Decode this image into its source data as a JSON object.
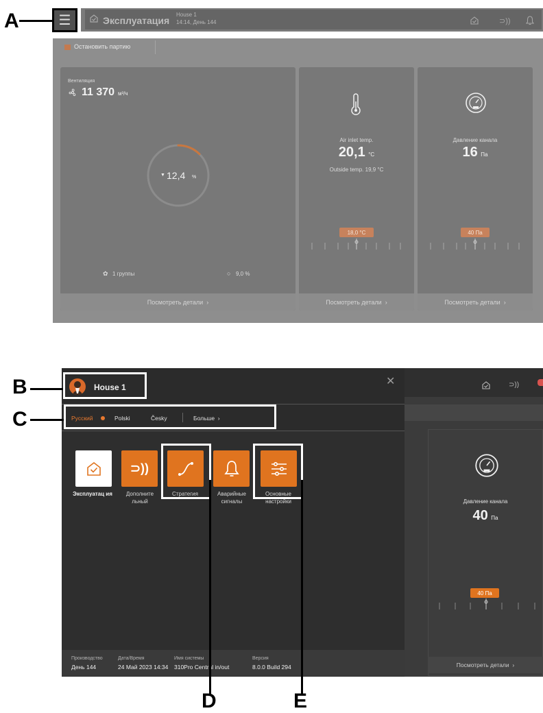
{
  "callouts": {
    "a": "A",
    "b": "B",
    "c": "C",
    "d": "D",
    "e": "E"
  },
  "top": {
    "menu_icon": "hamburger-icon",
    "header": {
      "title": "Эксплуатация",
      "house": "House 1",
      "time_day": "14:14, День 144",
      "icons": [
        "home-check-icon",
        "sound-waves-icon",
        "bell-icon"
      ]
    },
    "stop_batch": "Остановить партию",
    "ventilation": {
      "label": "Вентиляция",
      "value": "11 370",
      "unit": "м³/ч",
      "gauge_value": "12,4",
      "gauge_unit": "%",
      "gauge_fraction": 0.124,
      "groups": "1 группы",
      "side_value": "9,0 %",
      "details": "Посмотреть детали"
    },
    "air_inlet": {
      "label": "Air inlet temp.",
      "value": "20,1",
      "unit": "°C",
      "outside": "Outside temp. 19,9 °C",
      "chip": "18,0 °C",
      "details": "Посмотреть детали"
    },
    "pressure": {
      "label": "Давление канала",
      "value": "16",
      "unit": "Па",
      "chip": "40 Па",
      "details": "Посмотреть детали"
    }
  },
  "bottom": {
    "house_name": "House 1",
    "close_icon": "close-icon",
    "languages": {
      "active": "Русский",
      "others": [
        "Polski",
        "Česky"
      ],
      "more": "Больше"
    },
    "menu_tiles": [
      {
        "label": "Эксплуатац ия",
        "icon": "home-check-icon"
      },
      {
        "label": "Дополните льный",
        "icon": "sound-waves-icon"
      },
      {
        "label": "Стратегия",
        "icon": "curve-icon"
      },
      {
        "label": "Аварийные сигналы",
        "icon": "bell-icon"
      },
      {
        "label": "Основные настройки",
        "icon": "sliders-icon"
      }
    ],
    "footer": {
      "production_label": "Производство",
      "production_value": "День 144",
      "datetime_label": "Дата/Время",
      "datetime_value": "24 Май 2023 14:34",
      "system_label": "Имя системы",
      "system_value": "310Pro Central in/out",
      "version_label": "Версия",
      "version_value": "8.0.0 Build 294"
    },
    "right_card": {
      "label": "Давление канала",
      "value": "40",
      "unit": "Па",
      "chip": "40 Па",
      "details": "Посмотреть детали"
    }
  },
  "colors": {
    "accent": "#e8792f",
    "tile_orange": "#e0741f",
    "dark_bg": "#2e2e2e"
  }
}
